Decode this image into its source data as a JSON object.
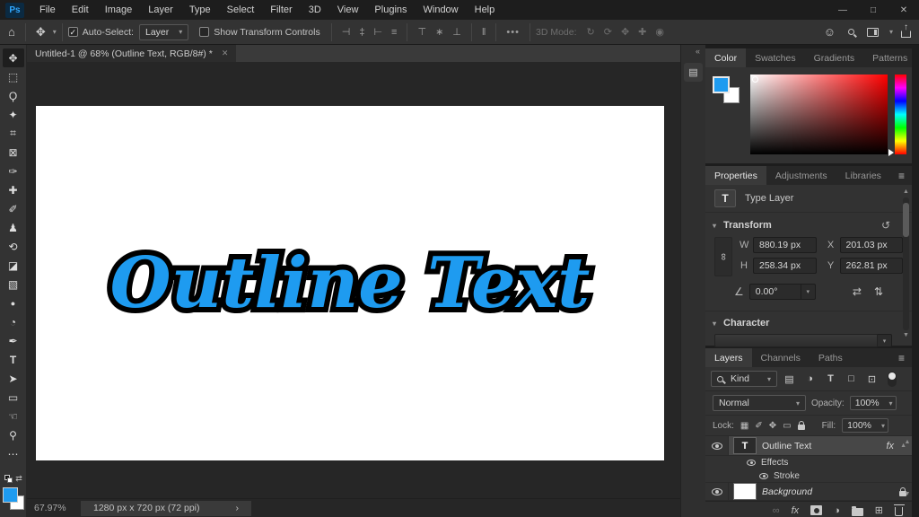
{
  "titlebar": {
    "logo_text": "Ps",
    "menus": [
      "File",
      "Edit",
      "Image",
      "Layer",
      "Type",
      "Select",
      "Filter",
      "3D",
      "View",
      "Plugins",
      "Window",
      "Help"
    ],
    "window_controls": {
      "minimize": "—",
      "maximize": "□",
      "close": "✕"
    }
  },
  "options": {
    "home_glyph": "⌂",
    "move_glyph": "✥",
    "auto_select_check": "✓",
    "auto_select_label": "Auto-Select:",
    "auto_select_value": "Layer",
    "show_transform_label": "Show Transform Controls",
    "align_icons": [
      {
        "name": "align-left-edges-icon",
        "glyph": "⊣"
      },
      {
        "name": "align-horizontal-centers-icon",
        "glyph": "‡"
      },
      {
        "name": "align-right-edges-icon",
        "glyph": "⊢"
      },
      {
        "name": "align-justify-icon",
        "glyph": "≡"
      },
      {
        "name": "align-top-edges-icon",
        "glyph": "⊤"
      },
      {
        "name": "align-vertical-centers-icon",
        "glyph": "∗"
      },
      {
        "name": "align-bottom-edges-icon",
        "glyph": "⊥"
      },
      {
        "name": "distribute-icon",
        "glyph": "‖"
      }
    ],
    "ellipsis_glyph": "•••",
    "mode_label": "3D Mode:",
    "mode_icons": [
      {
        "name": "3d-orbit-icon",
        "glyph": "↻"
      },
      {
        "name": "3d-roll-icon",
        "glyph": "⟳"
      },
      {
        "name": "3d-drag-icon",
        "glyph": "✥"
      },
      {
        "name": "3d-slide-icon",
        "glyph": "✚"
      },
      {
        "name": "3d-camera-icon",
        "glyph": "◉"
      }
    ],
    "account_glyph": "☺"
  },
  "toolbar": {
    "tools": [
      {
        "name": "move-tool",
        "glyph": "✥"
      },
      {
        "name": "marquee-tool",
        "glyph": "⬚"
      },
      {
        "name": "lasso-tool",
        "glyph": "Ϙ"
      },
      {
        "name": "object-selection-tool",
        "glyph": "✦"
      },
      {
        "name": "crop-tool",
        "glyph": "⌗"
      },
      {
        "name": "frame-tool",
        "glyph": "⊠"
      },
      {
        "name": "eyedropper-tool",
        "glyph": "✑"
      },
      {
        "name": "healing-brush-tool",
        "glyph": "✚"
      },
      {
        "name": "brush-tool",
        "glyph": "✐"
      },
      {
        "name": "clone-stamp-tool",
        "glyph": "♟"
      },
      {
        "name": "history-brush-tool",
        "glyph": "⟲"
      },
      {
        "name": "eraser-tool",
        "glyph": "◪"
      },
      {
        "name": "gradient-tool",
        "glyph": "▧"
      },
      {
        "name": "blur-tool",
        "glyph": "●"
      },
      {
        "name": "dodge-tool",
        "glyph": "◔"
      },
      {
        "name": "pen-tool",
        "glyph": "✒"
      },
      {
        "name": "type-tool",
        "glyph": "T"
      },
      {
        "name": "path-selection-tool",
        "glyph": "➤"
      },
      {
        "name": "rectangle-tool",
        "glyph": "▭"
      },
      {
        "name": "hand-tool",
        "glyph": "☜"
      },
      {
        "name": "zoom-tool",
        "glyph": "⚲"
      },
      {
        "name": "edit-toolbar",
        "glyph": "⋯"
      }
    ],
    "foreground_color": "#1E9BF0",
    "background_color": "#FFFFFF",
    "swap_glyph": "⇄"
  },
  "document": {
    "tab_title": "Untitled-1 @ 68% (Outline Text, RGB/8#) *",
    "close_glyph": "✕",
    "canvas_text": "Outline Text",
    "text_fill_color": "#1E9BF0",
    "text_outline_color": "#000000",
    "zoom_level": "67.97%",
    "doc_info": "1280 px x 720 px (72 ppi)",
    "info_chevron": "›"
  },
  "dock": {
    "collapse_glyph": "«",
    "panel_icon_glyph": "▤"
  },
  "panels": {
    "menu_glyph": "≡",
    "color": {
      "tabs": [
        "Color",
        "Swatches",
        "Gradients",
        "Patterns"
      ]
    },
    "properties": {
      "tabs": [
        "Properties",
        "Adjustments",
        "Libraries"
      ],
      "type_icon": "T",
      "layer_type": "Type Layer",
      "transform_title": "Transform",
      "reset_glyph": "↺",
      "link_glyph": "∞",
      "w_label": "W",
      "w_value": "880.19 px",
      "x_label": "X",
      "x_value": "201.03 px",
      "h_label": "H",
      "h_value": "258.34 px",
      "y_label": "Y",
      "y_value": "262.81 px",
      "angle_glyph": "∠",
      "angle_value": "0.00°",
      "flip_h_glyph": "⇄",
      "flip_v_glyph": "⇅",
      "character_title": "Character"
    },
    "layers": {
      "tabs": [
        "Layers",
        "Channels",
        "Paths"
      ],
      "kind_label": "Kind",
      "filter_icons": [
        {
          "name": "filter-pixel-layers-icon",
          "glyph": "▤"
        },
        {
          "name": "filter-adjustment-layers-icon",
          "glyph": "◑"
        },
        {
          "name": "filter-type-layers-icon",
          "glyph": "T"
        },
        {
          "name": "filter-shape-layers-icon",
          "glyph": "□"
        },
        {
          "name": "filter-smart-objects-icon",
          "glyph": "⊡"
        }
      ],
      "blend_mode": "Normal",
      "opacity_label": "Opacity:",
      "opacity_value": "100%",
      "lock_label": "Lock:",
      "lock_icons": [
        {
          "name": "lock-transparency-icon",
          "glyph": "▦"
        },
        {
          "name": "lock-pixels-icon",
          "glyph": "✐"
        },
        {
          "name": "lock-position-icon",
          "glyph": "✥"
        },
        {
          "name": "lock-artboard-icon",
          "glyph": "▭"
        }
      ],
      "fill_label": "Fill:",
      "fill_value": "100%",
      "thumb_t": "T",
      "fx_label": "fx",
      "rows": [
        {
          "label": "Outline Text"
        },
        {
          "label": "Effects"
        },
        {
          "label": "Stroke"
        },
        {
          "label": "Background"
        }
      ],
      "bottom_link_glyph": "∞",
      "bottom_fx_label": "fx",
      "bottom_adjust_glyph": "◑",
      "bottom_new_layer_glyph": "⊞"
    }
  }
}
